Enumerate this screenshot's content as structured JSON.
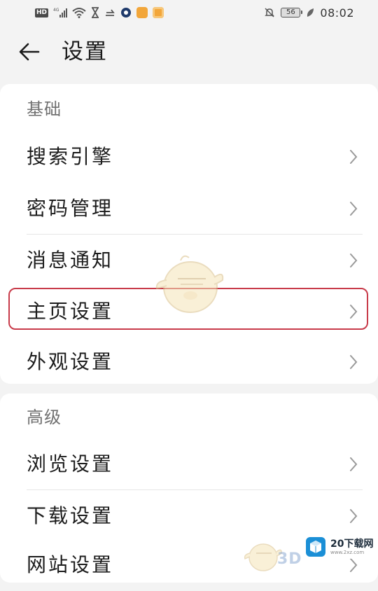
{
  "status_bar": {
    "hd": "HD",
    "network": "4G",
    "battery": "56",
    "time": "08:02",
    "icons": [
      "hd-icon",
      "signal-icon",
      "wifi-icon",
      "hourglass-icon",
      "data-speed-icon",
      "app-icon",
      "orange-app-icon",
      "orange-app-icon-2",
      "mute-icon",
      "battery-icon",
      "leaf-icon"
    ]
  },
  "header": {
    "back_icon": "arrow-left-icon",
    "title": "设置"
  },
  "sections": [
    {
      "label": "基础",
      "items": [
        "搜索引擎",
        "密码管理",
        "消息通知",
        "主页设置",
        "外观设置"
      ]
    },
    {
      "label": "高级",
      "items": [
        "浏览设置",
        "下载设置",
        "网站设置"
      ]
    }
  ],
  "highlight": {
    "item": "主页设置",
    "color": "#c83b4a"
  },
  "watermark": {
    "site": "20下载网",
    "site_sub": "www.2xz.com",
    "badge": "3D"
  },
  "colors": {
    "background": "#f3f3f3",
    "card": "#ffffff",
    "label": "#707070",
    "highlight": "#c83b4a"
  }
}
